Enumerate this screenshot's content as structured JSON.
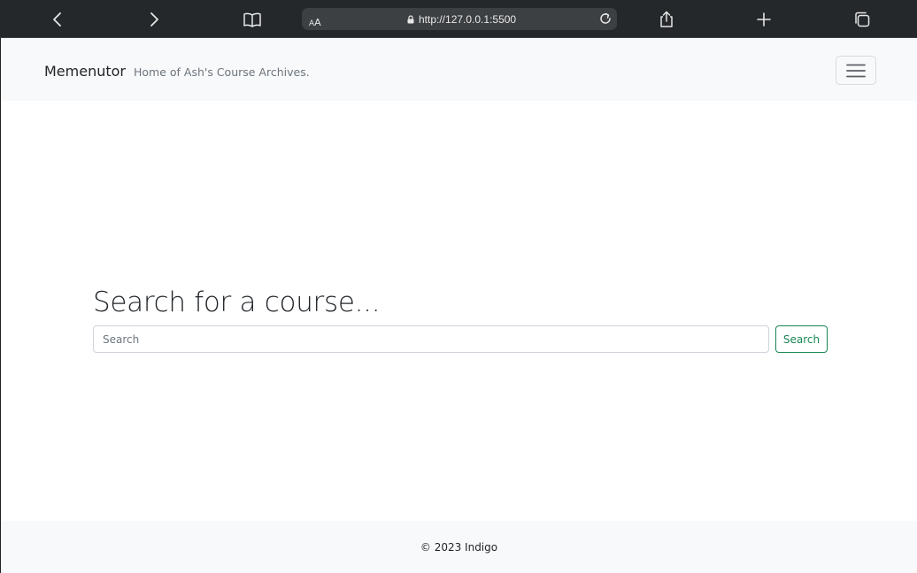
{
  "browser": {
    "url": "http://127.0.0.1:5500",
    "reader_label_small": "A",
    "reader_label_big": "A",
    "icons": [
      "back-icon",
      "forward-icon",
      "bookmarks-icon",
      "lock-icon",
      "reload-icon",
      "share-icon",
      "new-tab-icon",
      "tabs-icon"
    ]
  },
  "navbar": {
    "brand": "Memenutor",
    "tagline": "Home of Ash's Course Archives.",
    "toggler_icon": "hamburger-icon"
  },
  "main": {
    "heading": "Search for a course...",
    "search_placeholder": "Search",
    "search_button": "Search"
  },
  "footer": {
    "text": "© 2023 Indigo"
  },
  "colors": {
    "browser_bar": "#25282b",
    "address_bar": "#3d4043",
    "navbar_bg": "#f8f9fa",
    "accent_green": "#198754"
  }
}
